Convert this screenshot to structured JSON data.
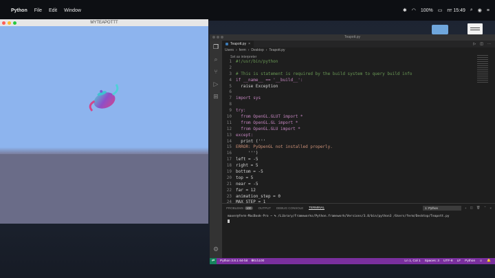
{
  "menubar": {
    "app_name": "Python",
    "menus": [
      "File",
      "Edit",
      "Window"
    ],
    "status_right": {
      "battery": "100%",
      "clock": "пт 15:49"
    }
  },
  "teapot_window": {
    "title": "MYTEAPOTTT"
  },
  "vscode": {
    "title": "Teapott.py",
    "tab_label": "Teapott.py",
    "breadcrumb": [
      "Users",
      "ferm",
      "Desktop",
      "Teapott.py"
    ],
    "interpreter_hint": "Set as interpreter",
    "code_lines": [
      {
        "n": "1",
        "text": "#!/usr/bin/python"
      },
      {
        "n": "2",
        "text": ""
      },
      {
        "n": "3",
        "text": "# This is statement is required by the build system to query build info"
      },
      {
        "n": "4",
        "text": "if __name__ == '__build__':"
      },
      {
        "n": "5",
        "text": "  raise Exception"
      },
      {
        "n": "6",
        "text": ""
      },
      {
        "n": "7",
        "text": "import sys"
      },
      {
        "n": "8",
        "text": ""
      },
      {
        "n": "9",
        "text": "try:"
      },
      {
        "n": "10",
        "text": "  from OpenGL.GLUT import *"
      },
      {
        "n": "11",
        "text": "  from OpenGL.GL import *"
      },
      {
        "n": "12",
        "text": "  from OpenGL.GLU import *"
      },
      {
        "n": "13",
        "text": "except:"
      },
      {
        "n": "14",
        "text": "  print ('''"
      },
      {
        "n": "15",
        "text": "ERROR: PyOpenGL not installed properly."
      },
      {
        "n": "16",
        "text": "     ''')"
      },
      {
        "n": "17",
        "text": "left = -5"
      },
      {
        "n": "18",
        "text": "right = 5"
      },
      {
        "n": "19",
        "text": "bottom = -5"
      },
      {
        "n": "20",
        "text": "top = 5"
      },
      {
        "n": "21",
        "text": "near = -5"
      },
      {
        "n": "22",
        "text": "far = 12"
      },
      {
        "n": "23",
        "text": "animation_step = 0"
      },
      {
        "n": "24",
        "text": "MAX_STEP = 1"
      }
    ],
    "panel": {
      "tabs": [
        {
          "label": "PROBLEMS",
          "badge": "100"
        },
        {
          "label": "OUTPUT"
        },
        {
          "label": "DEBUG CONSOLE"
        },
        {
          "label": "TERMINAL",
          "active": true
        }
      ],
      "terminal_select": "1: Python",
      "terminal_line": "maxer@ferm-MacBook-Pro ~ % /Library/Frameworks/Python.framework/Versions/3.8/bin/python3 /Users/ferm/Desktop/Teapott.py"
    },
    "statusbar": {
      "python": "Python 3.8.1 64-bit",
      "errors": "0",
      "warnings": "100",
      "position": "Ln 1, Col 1",
      "spaces": "Spaces: 3",
      "encoding": "UTF-8",
      "eol": "LF",
      "language": "Python"
    }
  }
}
